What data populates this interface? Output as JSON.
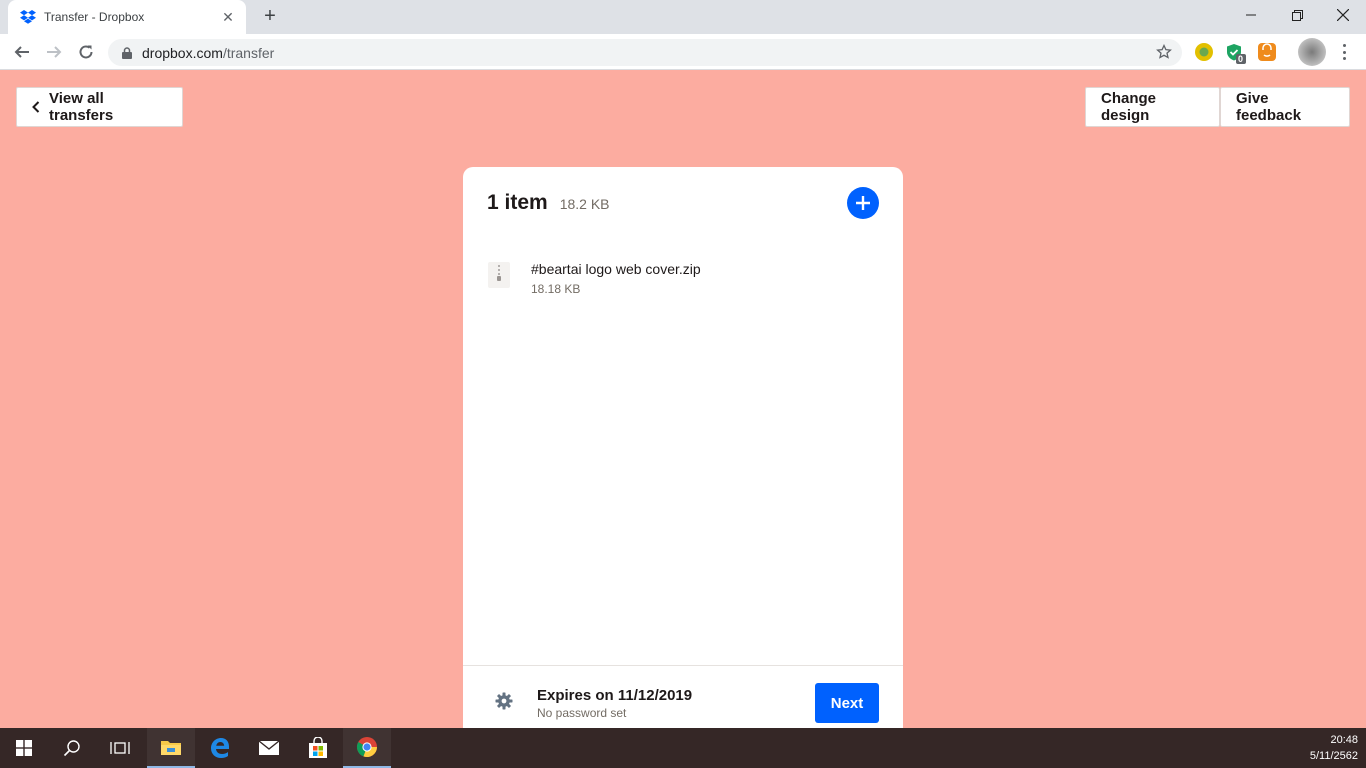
{
  "browser": {
    "tab_title": "Transfer - Dropbox",
    "url_host": "dropbox.com",
    "url_path": "/transfer",
    "extension_badge": "0"
  },
  "page": {
    "back_label": "View all transfers",
    "change_design_label": "Change design",
    "feedback_label": "Give feedback"
  },
  "transfer": {
    "item_count": "1 item",
    "total_size": "18.2 KB",
    "files": [
      {
        "name": "#beartai logo web cover.zip",
        "size": "18.18 KB"
      }
    ],
    "expires": "Expires on 11/12/2019",
    "password": "No password set",
    "next_label": "Next"
  },
  "taskbar": {
    "time": "20:48",
    "date": "5/11/2562"
  },
  "colors": {
    "page_background": "#fcaca0",
    "accent": "#0061fe"
  }
}
